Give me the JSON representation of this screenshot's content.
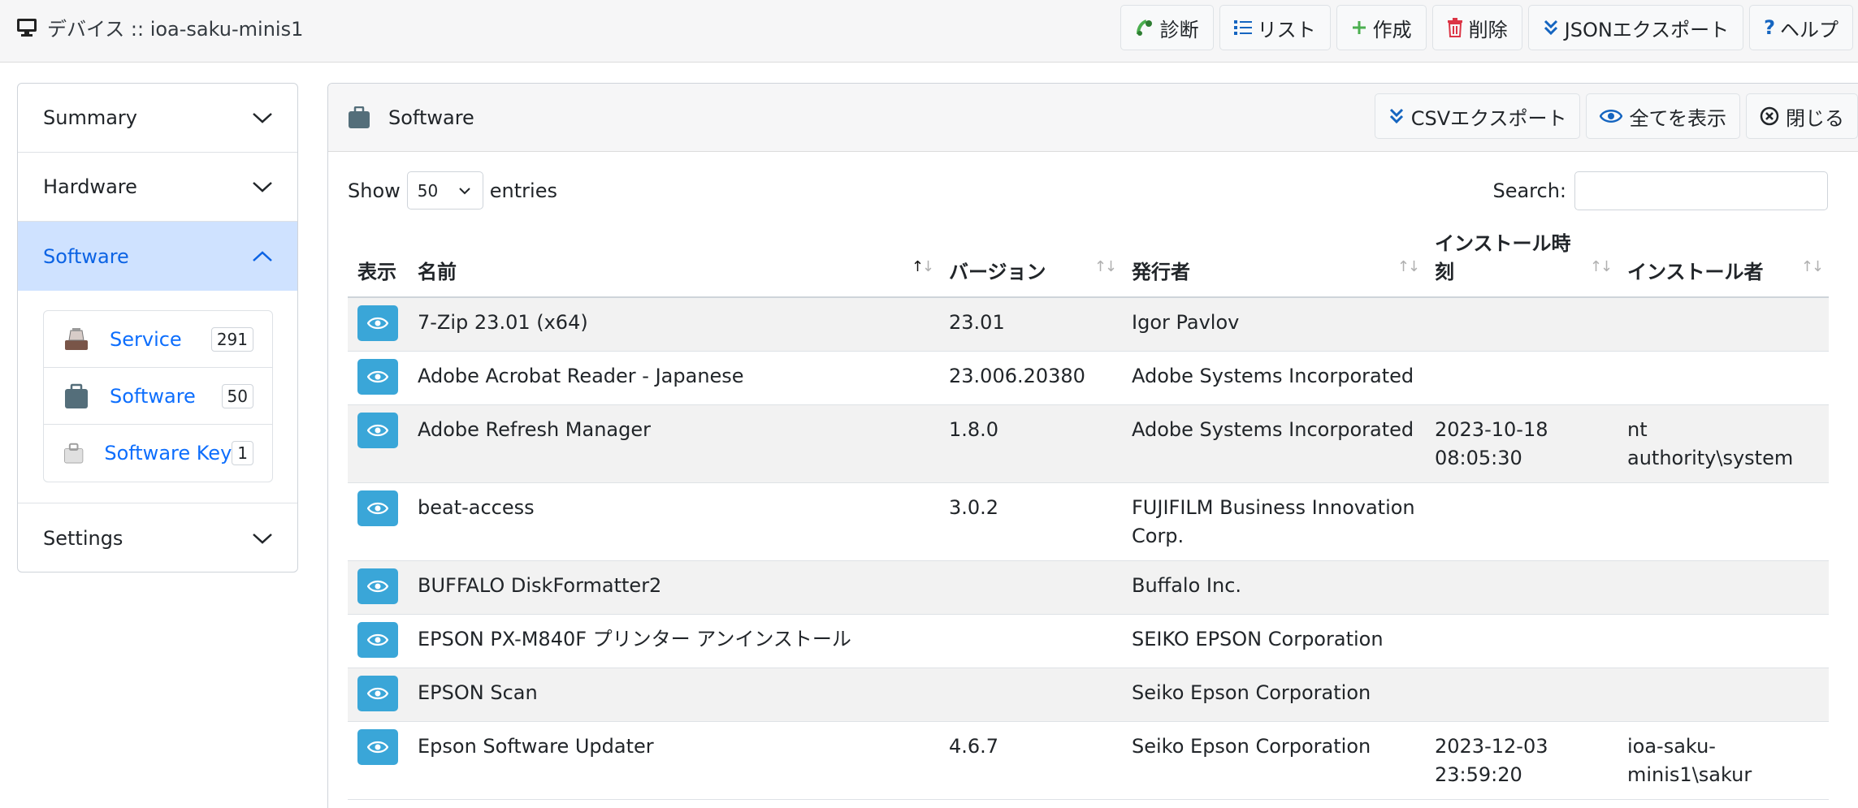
{
  "header": {
    "title": "デバイス :: ioa-saku-minis1",
    "buttons": [
      {
        "label": "診断",
        "icon": "diagnose-icon"
      },
      {
        "label": "リスト",
        "icon": "list-icon"
      },
      {
        "label": "作成",
        "icon": "plus-icon"
      },
      {
        "label": "削除",
        "icon": "trash-icon"
      },
      {
        "label": "JSONエクスポート",
        "icon": "export-icon"
      },
      {
        "label": "ヘルプ",
        "icon": "help-icon"
      }
    ]
  },
  "sidebar": {
    "sections": [
      {
        "label": "Summary"
      },
      {
        "label": "Hardware"
      },
      {
        "label": "Software"
      },
      {
        "label": "Settings"
      }
    ],
    "software_items": [
      {
        "label": "Service",
        "count": "291"
      },
      {
        "label": "Software",
        "count": "50"
      },
      {
        "label": "Software Key",
        "count": "1"
      }
    ]
  },
  "panel": {
    "title": "Software",
    "buttons": [
      {
        "label": "CSVエクスポート"
      },
      {
        "label": "全てを表示"
      },
      {
        "label": "閉じる"
      }
    ],
    "show_label": "Show",
    "entries_value": "50",
    "entries_label": "entries",
    "search_label": "Search:"
  },
  "table": {
    "columns": [
      "表示",
      "名前",
      "バージョン",
      "発行者",
      "インストール時刻",
      "インストール者"
    ],
    "rows": [
      {
        "name": "7-Zip 23.01 (x64)",
        "version": "23.01",
        "publisher": "Igor Pavlov",
        "installed": "",
        "installer": ""
      },
      {
        "name": "Adobe Acrobat Reader - Japanese",
        "version": "23.006.20380",
        "publisher": "Adobe Systems Incorporated",
        "installed": "",
        "installer": ""
      },
      {
        "name": "Adobe Refresh Manager",
        "version": "1.8.0",
        "publisher": "Adobe Systems Incorporated",
        "installed": "2023-10-18 08:05:30",
        "installer": "nt authority\\system"
      },
      {
        "name": "beat-access",
        "version": "3.0.2",
        "publisher": "FUJIFILM Business Innovation Corp.",
        "installed": "",
        "installer": ""
      },
      {
        "name": "BUFFALO DiskFormatter2",
        "version": "",
        "publisher": "Buffalo Inc.",
        "installed": "",
        "installer": ""
      },
      {
        "name": "EPSON PX-M840F プリンター アンインストール",
        "version": "",
        "publisher": "SEIKO EPSON Corporation",
        "installed": "",
        "installer": ""
      },
      {
        "name": "EPSON Scan",
        "version": "",
        "publisher": "Seiko Epson Corporation",
        "installed": "",
        "installer": ""
      },
      {
        "name": "Epson Software Updater",
        "version": "4.6.7",
        "publisher": "Seiko Epson Corporation",
        "installed": "2023-12-03 23:59:20",
        "installer": "ioa-saku-minis1\\sakur"
      }
    ]
  }
}
